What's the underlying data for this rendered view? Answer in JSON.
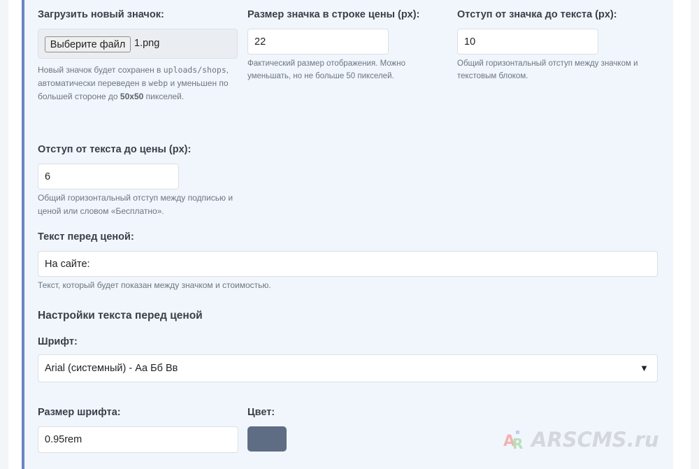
{
  "upload": {
    "label": "Загрузить новый значок:",
    "button": "Выберите файл",
    "filename": "1.png",
    "help_part1": "Новый значок будет сохранен в",
    "help_path": "uploads/shops",
    "help_part2": ", автоматически переведен в",
    "help_format": "webp",
    "help_part3": " и уменьшен по большей стороне до",
    "help_size": "50x50",
    "help_part4": " пикселей."
  },
  "icon_size": {
    "label": "Размер значка в строке цены (px):",
    "value": "22",
    "help": "Фактический размер отображения. Можно уменьшать, но не больше 50 пикселей."
  },
  "icon_gap": {
    "label": "Отступ от значка до текста (px):",
    "value": "10",
    "help": "Общий горизонтальный отступ между значком и текстовым блоком."
  },
  "text_gap": {
    "label": "Отступ от текста до цены (px):",
    "value": "6",
    "help": "Общий горизонтальный отступ между подписью и ценой или словом «Бесплатно»."
  },
  "pre_text": {
    "label": "Текст перед ценой:",
    "value": "На сайте:",
    "help": "Текст, который будет показан между значком и стоимостью."
  },
  "text_settings": {
    "title": "Настройки текста перед ценой",
    "font_label": "Шрифт:",
    "font_value": "Arial (системный) - Аа Бб Вв",
    "size_label": "Размер шрифта:",
    "size_value": "0.95rem",
    "color_label": "Цвет:",
    "color_value": "#5f6d84"
  },
  "watermark": {
    "text": "ARSCMS.ru",
    "logo_letters": "AR"
  },
  "colors": {
    "accent_border": "#6b86c6",
    "card_bg": "#f1f6fd"
  }
}
